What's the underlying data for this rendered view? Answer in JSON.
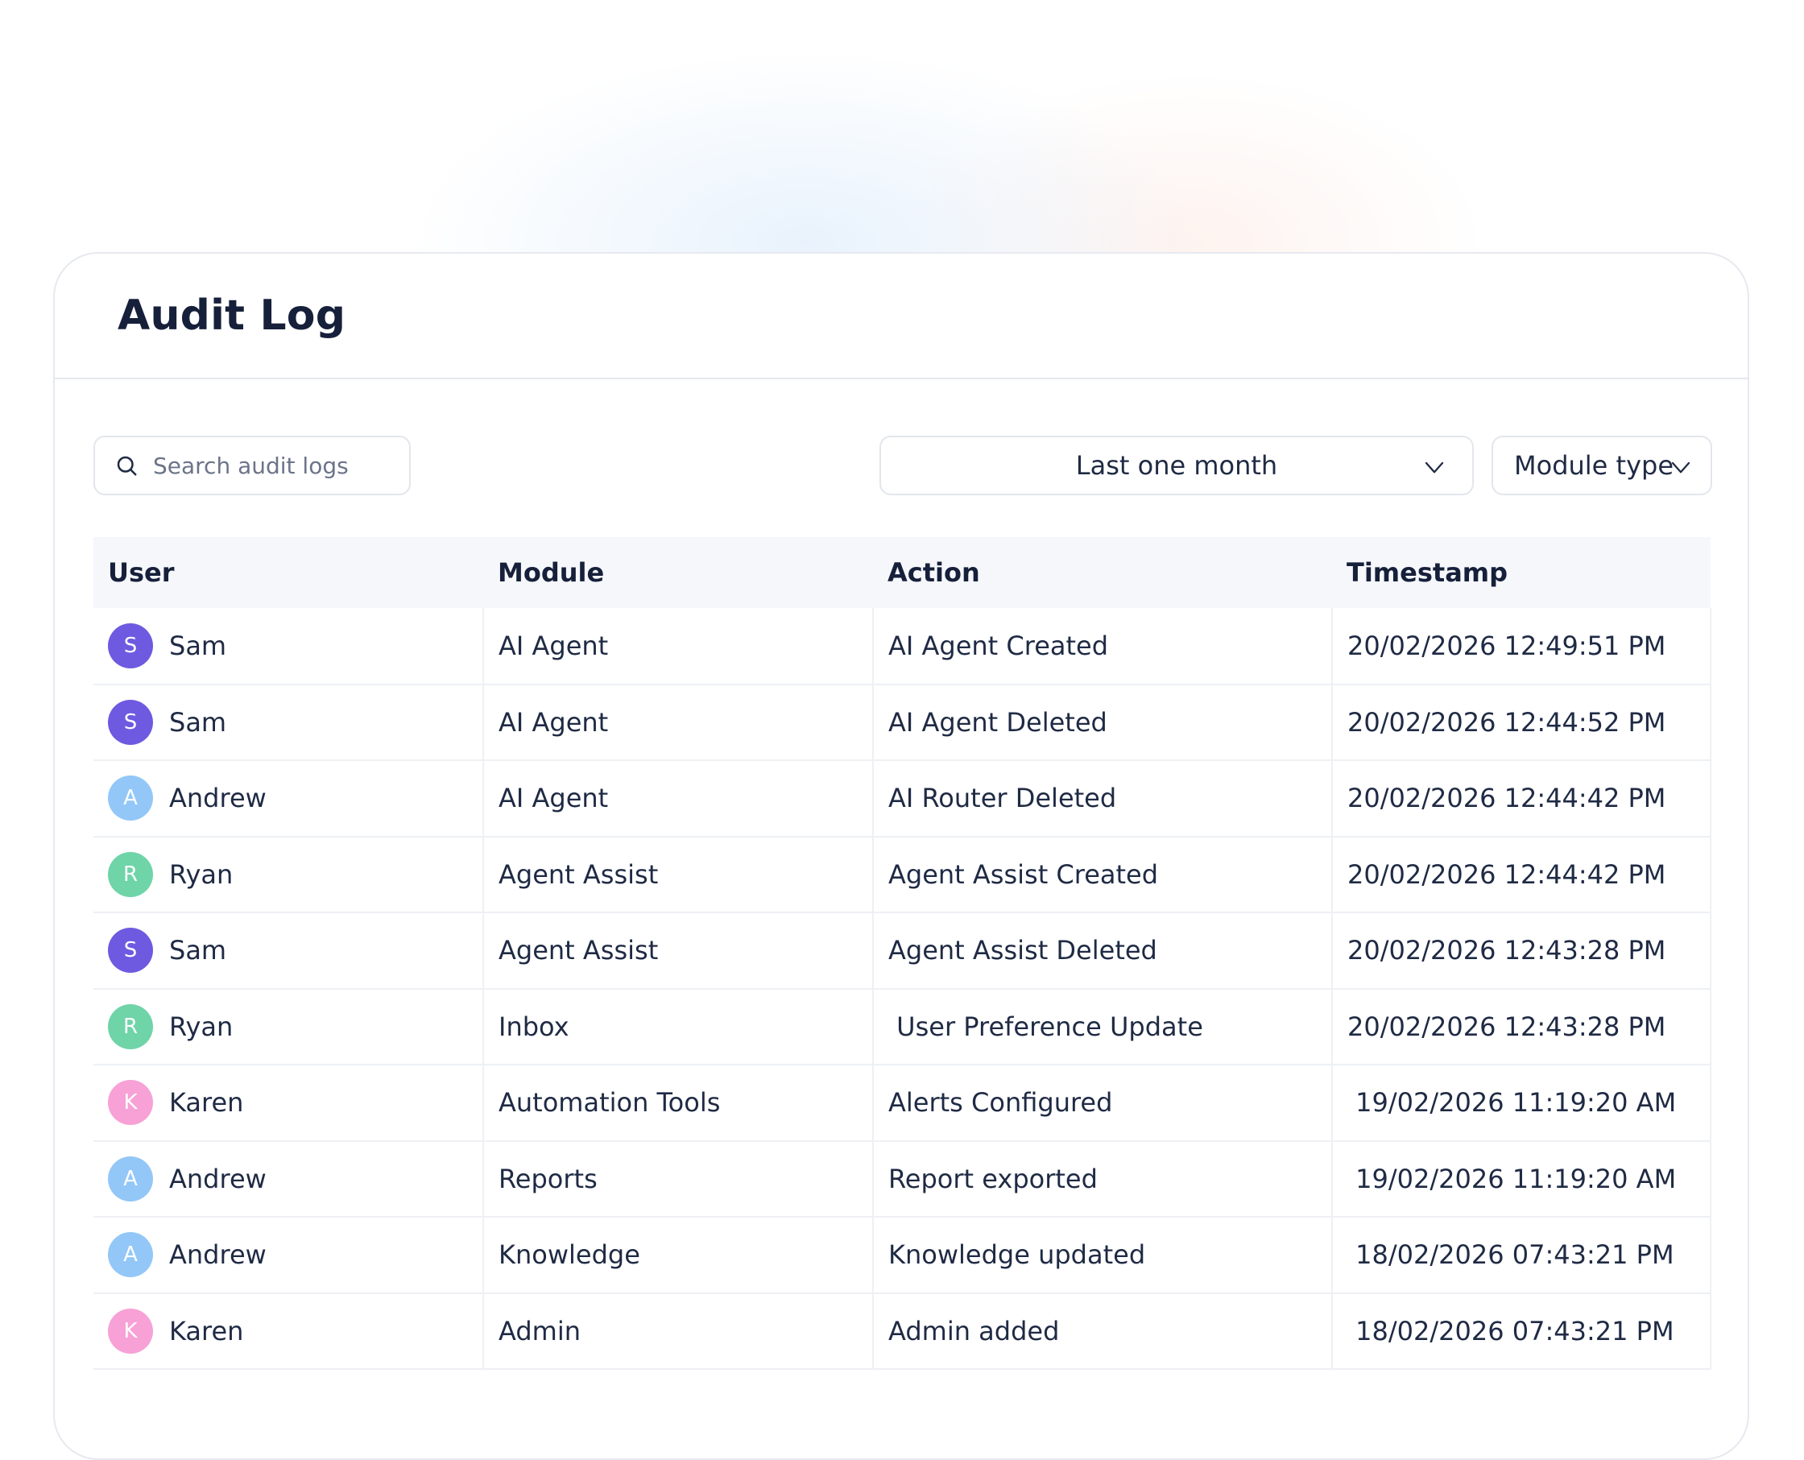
{
  "page": {
    "title": "Audit Log"
  },
  "search": {
    "placeholder": "Search audit logs",
    "value": ""
  },
  "filters": {
    "date_range": {
      "selected": "Last one month"
    },
    "module_type": {
      "selected": "Module type"
    }
  },
  "table": {
    "columns": [
      "User",
      "Module",
      "Action",
      "Timestamp"
    ],
    "rows": [
      {
        "initial": "S",
        "user": "Sam",
        "avatar_color": "#6e5ae0",
        "module": "AI Agent",
        "action": "AI Agent Created",
        "timestamp": "20/02/2026 12:49:51 PM"
      },
      {
        "initial": "S",
        "user": "Sam",
        "avatar_color": "#6e5ae0",
        "module": "AI Agent",
        "action": "AI Agent Deleted",
        "timestamp": "20/02/2026 12:44:52 PM"
      },
      {
        "initial": "A",
        "user": "Andrew",
        "avatar_color": "#93c7f7",
        "module": "AI Agent",
        "action": "AI Router Deleted",
        "timestamp": "20/02/2026 12:44:42 PM"
      },
      {
        "initial": "R",
        "user": "Ryan",
        "avatar_color": "#6fd4a8",
        "module": "Agent Assist",
        "action": "Agent Assist Created",
        "timestamp": "20/02/2026 12:44:42 PM"
      },
      {
        "initial": "S",
        "user": "Sam",
        "avatar_color": "#6e5ae0",
        "module": "Agent Assist",
        "action": "Agent Assist Deleted",
        "timestamp": "20/02/2026 12:43:28 PM"
      },
      {
        "initial": "R",
        "user": "Ryan",
        "avatar_color": "#6fd4a8",
        "module": "Inbox",
        "action": " User Preference Update",
        "timestamp": "20/02/2026 12:43:28 PM"
      },
      {
        "initial": "K",
        "user": "Karen",
        "avatar_color": "#f7a1d6",
        "module": "Automation Tools",
        "action": "Alerts Configured",
        "timestamp": " 19/02/2026 11:19:20 AM"
      },
      {
        "initial": "A",
        "user": "Andrew",
        "avatar_color": "#93c7f7",
        "module": "Reports",
        "action": "Report exported",
        "timestamp": " 19/02/2026 11:19:20 AM"
      },
      {
        "initial": "A",
        "user": "Andrew",
        "avatar_color": "#93c7f7",
        "module": "Knowledge",
        "action": "Knowledge updated",
        "timestamp": " 18/02/2026 07:43:21 PM"
      },
      {
        "initial": "K",
        "user": "Karen",
        "avatar_color": "#f7a1d6",
        "module": "Admin",
        "action": "Admin added",
        "timestamp": " 18/02/2026 07:43:21 PM"
      }
    ]
  },
  "icons": {
    "search": "search-icon",
    "dropdown": "chevron-down-icon"
  },
  "colors": {
    "title": "#16203a",
    "text": "#1f2a44",
    "placeholder": "#6b7488",
    "header_bg": "#f5f7fb",
    "border": "#e6e9ef"
  }
}
